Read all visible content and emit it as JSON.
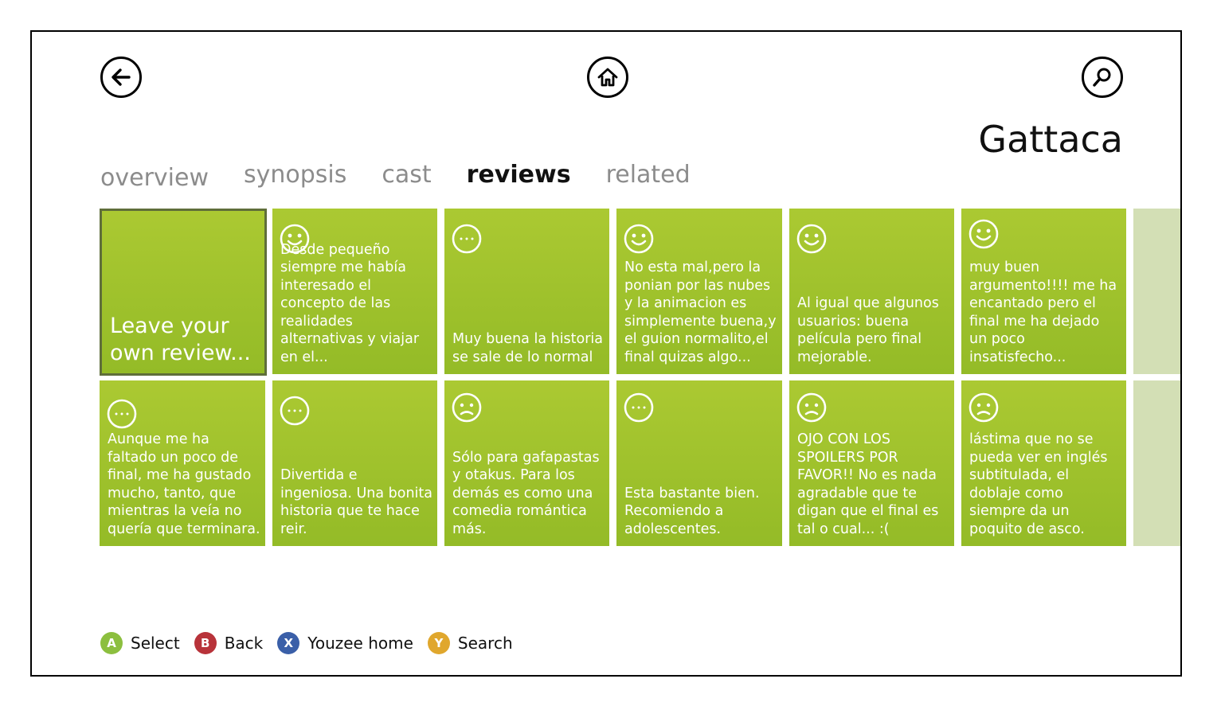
{
  "nav": {
    "back_icon": "back-arrow-icon",
    "home_icon": "home-icon",
    "search_icon": "search-icon"
  },
  "title": "Gattaca",
  "tabs": [
    {
      "label": "overview",
      "active": false
    },
    {
      "label": "synopsis",
      "active": false
    },
    {
      "label": "cast",
      "active": false
    },
    {
      "label": "reviews",
      "active": true
    },
    {
      "label": "related",
      "active": false
    }
  ],
  "leave_review_label": "Leave your own review...",
  "reviews": [
    {
      "mood": "happy",
      "text": "Desde pequeño siempre me había interesado el concepto de las realidades alternativas y viajar en el..."
    },
    {
      "mood": "neutral",
      "text": "Muy buena la historia se sale de lo normal"
    },
    {
      "mood": "happy",
      "text": "No esta mal,pero la ponian por las nubes y la animacion es simplemente buena,y el guion normalito,el final quizas algo..."
    },
    {
      "mood": "happy",
      "text": "Al igual que algunos usuarios: buena película pero final mejorable."
    },
    {
      "mood": "happy",
      "text": "muy buen argumento!!!! me ha encantado pero el final me ha dejado un poco insatisfecho..."
    },
    {
      "mood": "neutral",
      "text": "Aunque me ha faltado un poco de final, me ha gustado mucho, tanto, que mientras la veía no quería que terminara."
    },
    {
      "mood": "neutral",
      "text": "Divertida e ingeniosa. Una bonita historia que te hace reir."
    },
    {
      "mood": "sad",
      "text": "Sólo para gafapastas y otakus. Para los demás es como una comedia romántica más."
    },
    {
      "mood": "neutral",
      "text": "Esta bastante bien. Recomiendo a adolescentes."
    },
    {
      "mood": "sad",
      "text": "OJO CON LOS SPOILERS POR FAVOR!! No es nada agradable que te digan que el final es tal o cual... :("
    },
    {
      "mood": "sad",
      "text": "lástima que no se pueda ver en inglés subtitulada, el doblaje como siempre da un poquito de asco."
    }
  ],
  "footer": [
    {
      "key": "A",
      "label": "Select",
      "color": "#8cbf3f"
    },
    {
      "key": "B",
      "label": "Back",
      "color": "#b8333a"
    },
    {
      "key": "X",
      "label": "Youzee home",
      "color": "#3a5fa8"
    },
    {
      "key": "Y",
      "label": "Search",
      "color": "#e0a72d"
    }
  ],
  "colors": {
    "tile": "#9bc22c",
    "tile_ghost": "#d3dfb5",
    "tile_border": "#5f6e3a"
  }
}
